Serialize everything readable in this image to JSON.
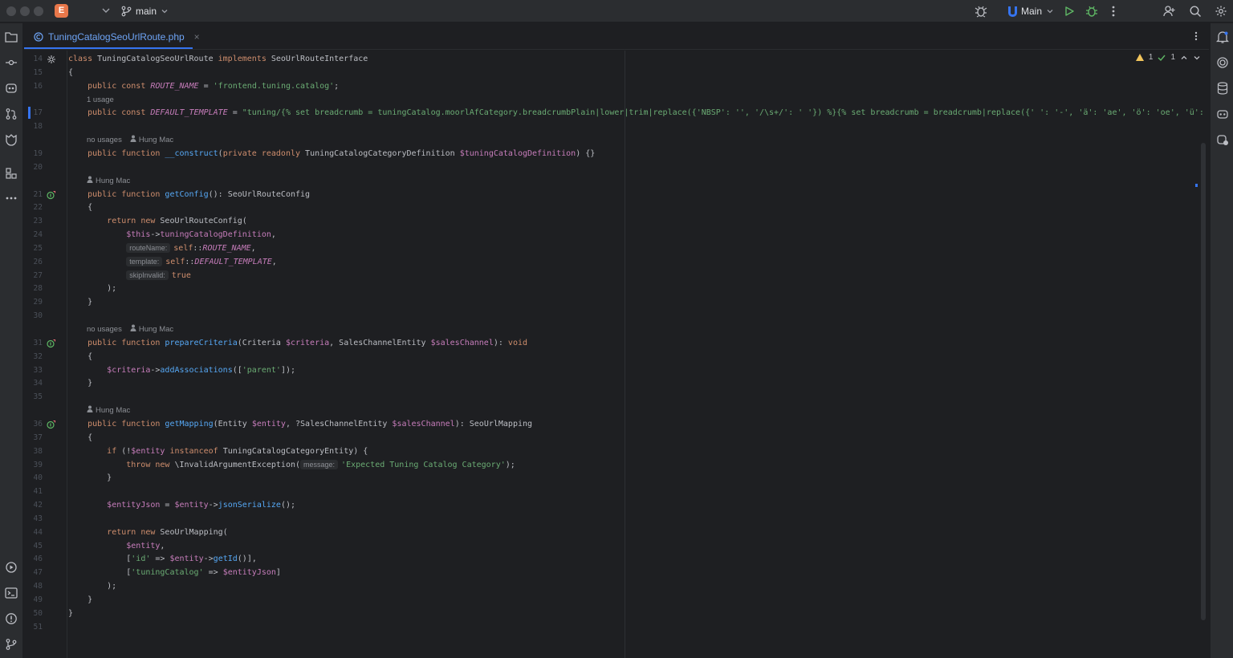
{
  "titlebar": {
    "project_badge": "E",
    "branch": "main",
    "run_config": "Main"
  },
  "tab": {
    "filename": "TuningCatalogSeoUrlRoute.php",
    "close": "×"
  },
  "inspections": {
    "warnings": "1",
    "weak_warnings": "1"
  },
  "editor": {
    "lines": [
      {
        "n": "14",
        "kind": "code"
      },
      {
        "n": "15",
        "kind": "code"
      },
      {
        "n": "16",
        "kind": "code"
      },
      {
        "n": "",
        "kind": "hint",
        "text": "1 usage"
      },
      {
        "n": "17",
        "kind": "code"
      },
      {
        "n": "18",
        "kind": "code"
      },
      {
        "n": "",
        "kind": "hint",
        "text": "no usages",
        "author": "Hung Mac"
      },
      {
        "n": "19",
        "kind": "code"
      },
      {
        "n": "20",
        "kind": "code"
      },
      {
        "n": "",
        "kind": "hint",
        "author": "Hung Mac"
      },
      {
        "n": "21",
        "kind": "code"
      },
      {
        "n": "22",
        "kind": "code"
      },
      {
        "n": "23",
        "kind": "code"
      },
      {
        "n": "24",
        "kind": "code"
      },
      {
        "n": "25",
        "kind": "code"
      },
      {
        "n": "26",
        "kind": "code"
      },
      {
        "n": "27",
        "kind": "code"
      },
      {
        "n": "28",
        "kind": "code"
      },
      {
        "n": "29",
        "kind": "code"
      },
      {
        "n": "30",
        "kind": "code"
      },
      {
        "n": "",
        "kind": "hint",
        "text": "no usages",
        "author": "Hung Mac"
      },
      {
        "n": "31",
        "kind": "code"
      },
      {
        "n": "32",
        "kind": "code"
      },
      {
        "n": "33",
        "kind": "code"
      },
      {
        "n": "34",
        "kind": "code"
      },
      {
        "n": "35",
        "kind": "code"
      },
      {
        "n": "",
        "kind": "hint",
        "author": "Hung Mac"
      },
      {
        "n": "36",
        "kind": "code"
      },
      {
        "n": "37",
        "kind": "code"
      },
      {
        "n": "38",
        "kind": "code"
      },
      {
        "n": "39",
        "kind": "code"
      },
      {
        "n": "40",
        "kind": "code"
      },
      {
        "n": "41",
        "kind": "code"
      },
      {
        "n": "42",
        "kind": "code"
      },
      {
        "n": "43",
        "kind": "code"
      },
      {
        "n": "44",
        "kind": "code"
      },
      {
        "n": "45",
        "kind": "code"
      },
      {
        "n": "46",
        "kind": "code"
      },
      {
        "n": "47",
        "kind": "code"
      },
      {
        "n": "48",
        "kind": "code"
      },
      {
        "n": "49",
        "kind": "code"
      },
      {
        "n": "50",
        "kind": "code"
      },
      {
        "n": "51",
        "kind": "code"
      }
    ],
    "code": {
      "l14": [
        [
          "kw",
          "class "
        ],
        [
          "",
          "TuningCatalogSeoUrlRoute "
        ],
        [
          "kw",
          "implements "
        ],
        [
          "",
          "SeoUrlRouteInterface"
        ]
      ],
      "l15": [
        [
          "",
          "{"
        ]
      ],
      "l16": [
        [
          "",
          "    "
        ],
        [
          "kw",
          "public const "
        ],
        [
          "const",
          "ROUTE_NAME"
        ],
        [
          "",
          " = "
        ],
        [
          "str",
          "'frontend.tuning.catalog'"
        ],
        [
          "",
          ";"
        ]
      ],
      "l17": [
        [
          "",
          "    "
        ],
        [
          "kw",
          "public const "
        ],
        [
          "const",
          "DEFAULT_TEMPLATE"
        ],
        [
          "",
          " = "
        ],
        [
          "str",
          "\"tuning/{% set breadcrumb = tuningCatalog.moorlAfCategory.breadcrumbPlain|lower|trim|replace({'NBSP': '', '/\\s+/': ' '}) %}{% set breadcrumb = breadcrumb|replace({' ': '-', 'ä': 'ae', 'ö': 'oe', 'ü': 'ue', 'ß':"
        ]
      ],
      "l18": [],
      "l19": [
        [
          "",
          "    "
        ],
        [
          "kw",
          "public function "
        ],
        [
          "fn",
          "__construct"
        ],
        [
          "",
          "("
        ],
        [
          "kw",
          "private readonly "
        ],
        [
          "",
          "TuningCatalogCategoryDefinition "
        ],
        [
          "var",
          "$tuningCatalogDefinition"
        ],
        [
          "",
          ") {}"
        ]
      ],
      "l20": [],
      "l21": [
        [
          "",
          "    "
        ],
        [
          "kw",
          "public function "
        ],
        [
          "fn",
          "getConfig"
        ],
        [
          "",
          "(): SeoUrlRouteConfig"
        ]
      ],
      "l22": [
        [
          "",
          "    {"
        ]
      ],
      "l23": [
        [
          "",
          "        "
        ],
        [
          "kw",
          "return new "
        ],
        [
          "",
          "SeoUrlRouteConfig("
        ]
      ],
      "l24": [
        [
          "",
          "            "
        ],
        [
          "var",
          "$this"
        ],
        [
          "",
          "->"
        ],
        [
          "var",
          "tuningCatalogDefinition"
        ],
        [
          "",
          ","
        ]
      ],
      "l25": [
        [
          "",
          "            "
        ],
        [
          "param",
          "routeName:"
        ],
        [
          "kw",
          "self"
        ],
        [
          "",
          "::"
        ],
        [
          "const",
          "ROUTE_NAME"
        ],
        [
          "",
          ","
        ]
      ],
      "l26": [
        [
          "",
          "            "
        ],
        [
          "param",
          "template:"
        ],
        [
          "kw",
          "self"
        ],
        [
          "",
          "::"
        ],
        [
          "const",
          "DEFAULT_TEMPLATE"
        ],
        [
          "",
          ","
        ]
      ],
      "l27": [
        [
          "",
          "            "
        ],
        [
          "param",
          "skipInvalid:"
        ],
        [
          "kw",
          "true"
        ]
      ],
      "l28": [
        [
          "",
          "        );"
        ]
      ],
      "l29": [
        [
          "",
          "    }"
        ]
      ],
      "l30": [],
      "l31": [
        [
          "",
          "    "
        ],
        [
          "kw",
          "public function "
        ],
        [
          "fn",
          "prepareCriteria"
        ],
        [
          "",
          "(Criteria "
        ],
        [
          "var",
          "$criteria"
        ],
        [
          "",
          ", SalesChannelEntity "
        ],
        [
          "var",
          "$salesChannel"
        ],
        [
          "",
          "): "
        ],
        [
          "kw",
          "void"
        ]
      ],
      "l32": [
        [
          "",
          "    {"
        ]
      ],
      "l33": [
        [
          "",
          "        "
        ],
        [
          "var",
          "$criteria"
        ],
        [
          "",
          "->"
        ],
        [
          "fn",
          "addAssociations"
        ],
        [
          "",
          "(["
        ],
        [
          "str",
          "'parent'"
        ],
        [
          "",
          "]);"
        ]
      ],
      "l34": [
        [
          "",
          "    }"
        ]
      ],
      "l35": [],
      "l36": [
        [
          "",
          "    "
        ],
        [
          "kw",
          "public function "
        ],
        [
          "fn",
          "getMapping"
        ],
        [
          "",
          "(Entity "
        ],
        [
          "var",
          "$entity"
        ],
        [
          "",
          ", ?SalesChannelEntity "
        ],
        [
          "var",
          "$salesChannel"
        ],
        [
          "",
          "): SeoUrlMapping"
        ]
      ],
      "l37": [
        [
          "",
          "    {"
        ]
      ],
      "l38": [
        [
          "",
          "        "
        ],
        [
          "kw",
          "if "
        ],
        [
          "",
          "(!"
        ],
        [
          "var",
          "$entity "
        ],
        [
          "kw",
          "instanceof "
        ],
        [
          "",
          "TuningCatalogCategoryEntity) {"
        ]
      ],
      "l39": [
        [
          "",
          "            "
        ],
        [
          "kw",
          "throw new "
        ],
        [
          "",
          "\\InvalidArgumentException("
        ],
        [
          "param",
          "message:"
        ],
        [
          "str",
          "'Expected Tuning Catalog Category'"
        ],
        [
          "",
          ");"
        ]
      ],
      "l40": [
        [
          "",
          "        }"
        ]
      ],
      "l41": [],
      "l42": [
        [
          "",
          "        "
        ],
        [
          "var",
          "$entityJson"
        ],
        [
          "",
          " = "
        ],
        [
          "var",
          "$entity"
        ],
        [
          "",
          "->"
        ],
        [
          "fn",
          "jsonSerialize"
        ],
        [
          "",
          "();"
        ]
      ],
      "l43": [],
      "l44": [
        [
          "",
          "        "
        ],
        [
          "kw",
          "return new "
        ],
        [
          "",
          "SeoUrlMapping("
        ]
      ],
      "l45": [
        [
          "",
          "            "
        ],
        [
          "var",
          "$entity"
        ],
        [
          "",
          ","
        ]
      ],
      "l46": [
        [
          "",
          "            ["
        ],
        [
          "str",
          "'id'"
        ],
        [
          "",
          " => "
        ],
        [
          "var",
          "$entity"
        ],
        [
          "",
          "->"
        ],
        [
          "fn",
          "getId"
        ],
        [
          "",
          "()],"
        ]
      ],
      "l47": [
        [
          "",
          "            ["
        ],
        [
          "str",
          "'tuningCatalog'"
        ],
        [
          "",
          " => "
        ],
        [
          "var",
          "$entityJson"
        ],
        [
          "",
          "]"
        ]
      ],
      "l48": [
        [
          "",
          "        );"
        ]
      ],
      "l49": [
        [
          "",
          "    }"
        ]
      ],
      "l50": [
        [
          "",
          "}"
        ]
      ],
      "l51": []
    }
  },
  "colors": {
    "accent": "#3574f0",
    "keyword": "#cf8e6d",
    "string": "#6aab73",
    "function": "#56a8f5",
    "variable": "#c77dbb",
    "background": "#1e1f22"
  },
  "icons": {
    "left_strip": [
      "folder-icon",
      "commit-icon",
      "ai-assistant-icon",
      "pull-requests-icon",
      "bookmark-icon",
      "structure-icon",
      "more-tools-icon"
    ],
    "left_strip_bottom": [
      "services-icon",
      "terminal-icon",
      "problems-icon",
      "git-icon"
    ],
    "right_strip": [
      "notifications-icon",
      "ai-chat-icon",
      "database-icon",
      "copilot-icon",
      "assistant-icon"
    ]
  }
}
